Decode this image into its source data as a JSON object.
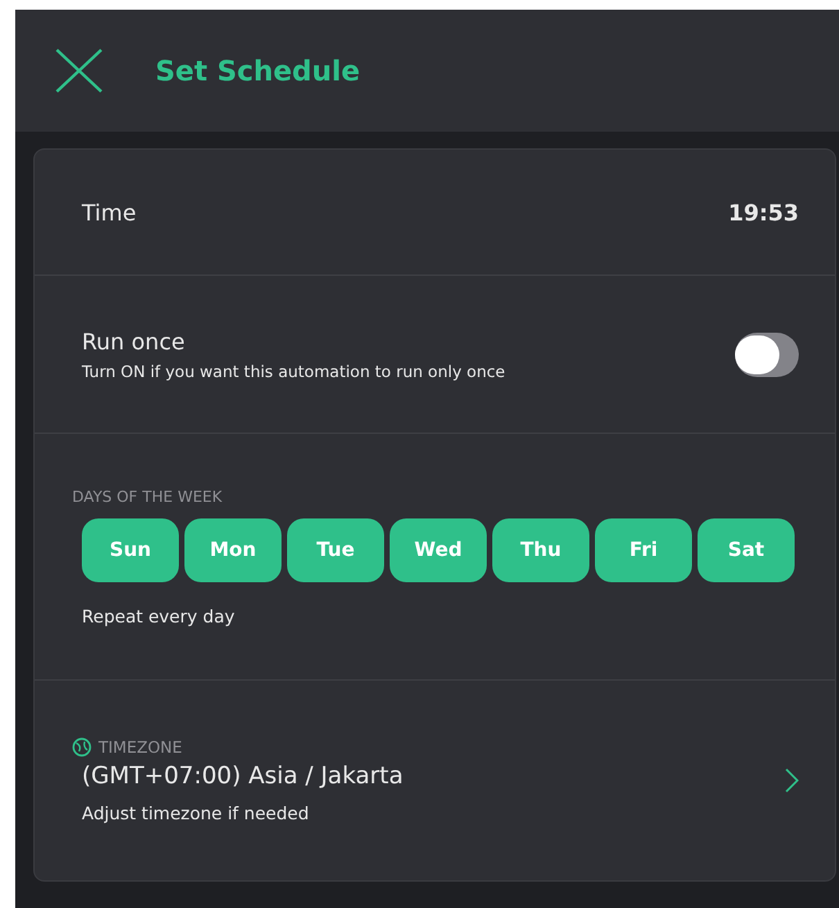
{
  "header": {
    "title": "Set Schedule"
  },
  "time": {
    "label": "Time",
    "value": "19:53"
  },
  "run_once": {
    "label": "Run once",
    "description": "Turn ON if you want this automation to run only once",
    "on": false
  },
  "days": {
    "heading": "DAYS OF THE WEEK",
    "items": [
      {
        "label": "Sun",
        "selected": true
      },
      {
        "label": "Mon",
        "selected": true
      },
      {
        "label": "Tue",
        "selected": true
      },
      {
        "label": "Wed",
        "selected": true
      },
      {
        "label": "Thu",
        "selected": true
      },
      {
        "label": "Fri",
        "selected": true
      },
      {
        "label": "Sat",
        "selected": true
      }
    ],
    "summary": "Repeat every day"
  },
  "timezone": {
    "heading": "TIMEZONE",
    "value": "(GMT+07:00) Asia / Jakarta",
    "hint": "Adjust timezone if needed"
  }
}
